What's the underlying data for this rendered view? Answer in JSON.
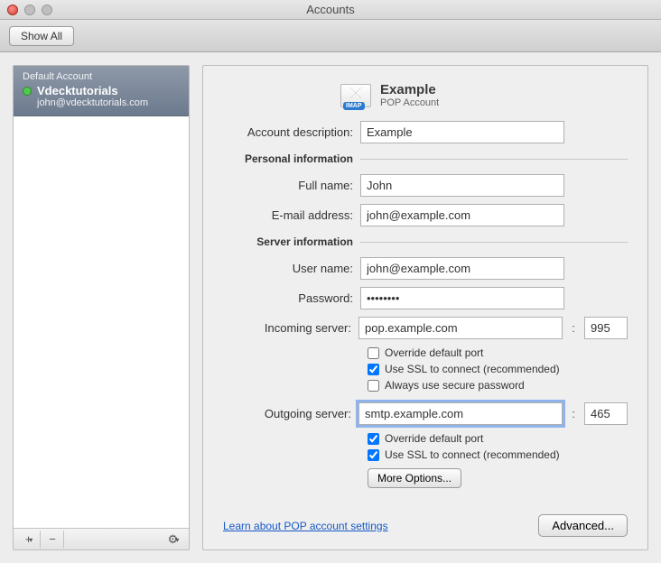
{
  "window": {
    "title": "Accounts"
  },
  "toolbar": {
    "show_all": "Show All"
  },
  "sidebar": {
    "default_label": "Default Account",
    "account_name": "Vdecktutorials",
    "account_email": "john@vdecktutorials.com",
    "add_symbol": "+",
    "add_dropdown": "▾",
    "remove_symbol": "−",
    "gear_dropdown": "▾"
  },
  "header": {
    "account_title": "Example",
    "account_type": "POP Account",
    "imap_badge": "IMAP"
  },
  "labels": {
    "description": "Account description:",
    "personal_info": "Personal information",
    "full_name": "Full name:",
    "email": "E-mail address:",
    "server_info": "Server information",
    "user_name": "User name:",
    "password": "Password:",
    "incoming": "Incoming server:",
    "outgoing": "Outgoing server:",
    "colon": ":"
  },
  "values": {
    "description": "Example",
    "full_name": "John",
    "email": "john@example.com",
    "user_name": "john@example.com",
    "password": "••••••••",
    "incoming_server": "pop.example.com",
    "incoming_port": "995",
    "outgoing_server": "smtp.example.com",
    "outgoing_port": "465"
  },
  "checkboxes": {
    "in_override": {
      "label": "Override default port",
      "checked": false
    },
    "in_ssl": {
      "label": "Use SSL to connect (recommended)",
      "checked": true
    },
    "in_secure_pw": {
      "label": "Always use secure password",
      "checked": false
    },
    "out_override": {
      "label": "Override default port",
      "checked": true
    },
    "out_ssl": {
      "label": "Use SSL to connect (recommended)",
      "checked": true
    }
  },
  "buttons": {
    "more_options": "More Options...",
    "advanced": "Advanced...",
    "learn": "Learn about POP account settings"
  }
}
